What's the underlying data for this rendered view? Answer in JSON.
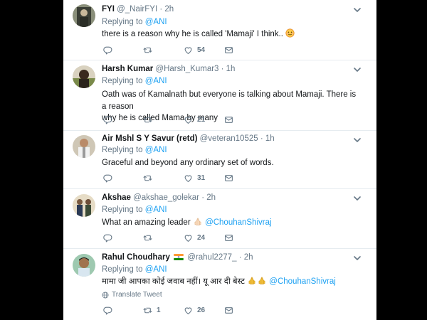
{
  "tweets": [
    {
      "name": "FYI",
      "handle": "@_NairFYI",
      "time": "· 2h",
      "replying_prefix": "Replying to",
      "replying_handle": "@ANI",
      "text": "there is a reason why he is called 'Mamaji' I think..",
      "replies": "",
      "retweets": "",
      "likes": "54"
    },
    {
      "name": "Harsh Kumar",
      "handle": "@Harsh_Kumar3",
      "time": "· 1h",
      "replying_prefix": "Replying to",
      "replying_handle": "@ANI",
      "text_line1": "Oath was of Kamalnath but everyone is talking about Mamaji. There is a reason",
      "text_line2": "why he is called Mama by many",
      "replies": "",
      "retweets": "",
      "likes": "21"
    },
    {
      "name": "Air Mshl S Y Savur (retd)",
      "handle": "@veteran10525",
      "time": "· 1h",
      "replying_prefix": "Replying to",
      "replying_handle": "@ANI",
      "text": "Graceful and beyond any ordinary set of words.",
      "replies": "",
      "retweets": "",
      "likes": "31"
    },
    {
      "name": "Akshae",
      "handle": "@akshae_golekar",
      "time": "· 2h",
      "replying_prefix": "Replying to",
      "replying_handle": "@ANI",
      "text": "What an amazing leader",
      "mention": "@ChouhanShivraj",
      "replies": "",
      "retweets": "",
      "likes": "24"
    },
    {
      "name": "Rahul Choudhary",
      "handle": "@rahul2277_",
      "time": "· 2h",
      "replying_prefix": "Replying to",
      "replying_handle": "@ANI",
      "text": "मामा जी आपका कोई जवाब नहीं। यू आर दी बेस्ट",
      "mention": "@ChouhanShivraj",
      "translate": "Translate Tweet",
      "replies": "",
      "retweets": "1",
      "likes": "26"
    }
  ],
  "colors": {
    "link": "#1da1f2",
    "secondary_text": "#657786",
    "primary_text": "#14171a",
    "divider": "#e6ecf0",
    "background": "#000000"
  },
  "icons": [
    "reply-icon",
    "retweet-icon",
    "like-icon",
    "share-icon",
    "caret-down-icon",
    "globe-icon",
    "india-flag-icon",
    "smiling-emoji",
    "folded-hands-emoji"
  ]
}
